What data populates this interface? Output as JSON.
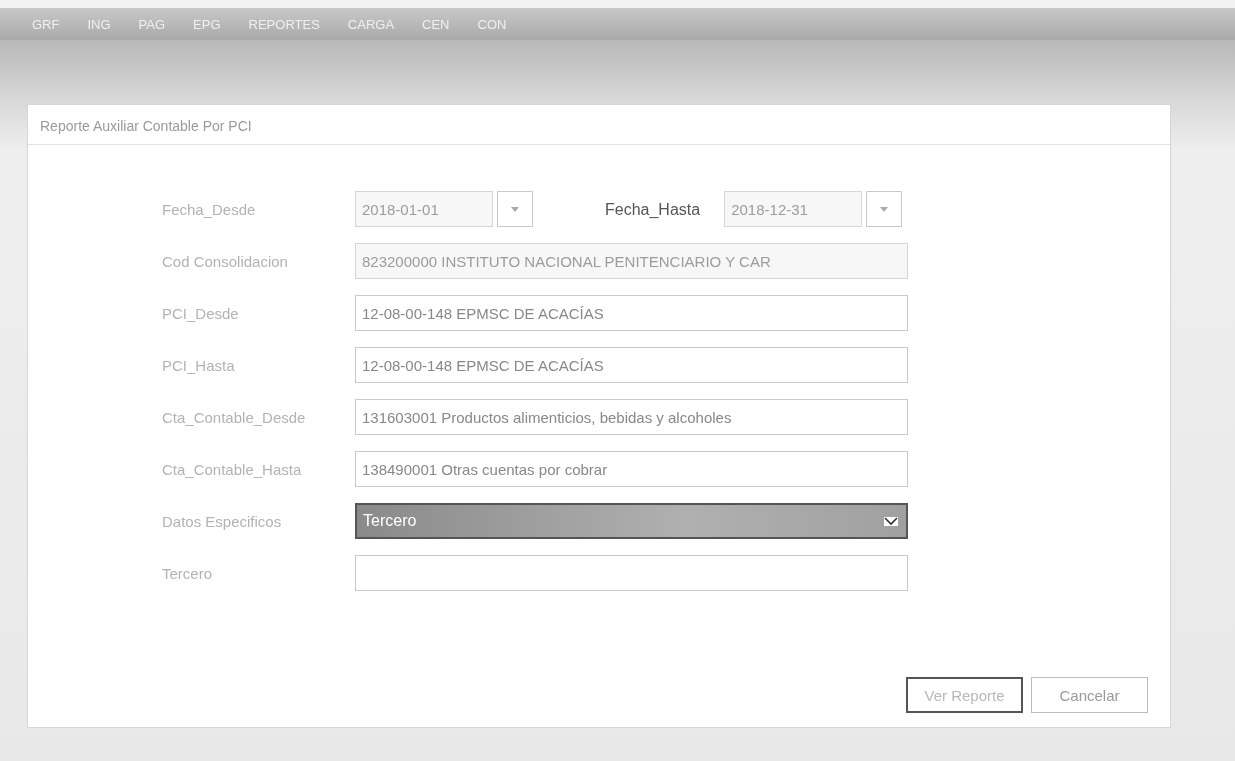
{
  "menu": [
    {
      "label": "GRF"
    },
    {
      "label": "ING"
    },
    {
      "label": "PAG"
    },
    {
      "label": "EPG"
    },
    {
      "label": "REPORTES"
    },
    {
      "label": "CARGA"
    },
    {
      "label": "CEN"
    },
    {
      "label": "CON"
    }
  ],
  "dialog": {
    "title": "Reporte Auxiliar Contable Por PCI",
    "rows": [
      {
        "fields": [
          {
            "kind": "date",
            "label": "Fecha_Desde",
            "value": "2018-01-01",
            "disabled": true
          },
          {
            "kind": "date",
            "label": "Fecha_Hasta",
            "value": "2018-12-31",
            "disabled": true
          }
        ]
      },
      {
        "fields": [
          {
            "kind": "text",
            "label": "Cod Consolidacion",
            "value": "823200000 INSTITUTO NACIONAL PENITENCIARIO Y CAR",
            "disabled": true
          }
        ]
      },
      {
        "fields": [
          {
            "kind": "text",
            "label": "PCI_Desde",
            "value": "12-08-00-148 EPMSC DE ACACÍAS",
            "disabled": false
          }
        ]
      },
      {
        "fields": [
          {
            "kind": "text",
            "label": "PCI_Hasta",
            "value": "12-08-00-148 EPMSC DE ACACÍAS",
            "disabled": false
          }
        ]
      },
      {
        "fields": [
          {
            "kind": "text",
            "label": "Cta_Contable_Desde",
            "value": "131603001 Productos alimenticios, bebidas y alcoholes",
            "disabled": false
          }
        ]
      },
      {
        "fields": [
          {
            "kind": "text",
            "label": "Cta_Contable_Hasta",
            "value": "138490001 Otras cuentas por cobrar",
            "disabled": false
          }
        ]
      },
      {
        "fields": [
          {
            "kind": "select",
            "label": "Datos Especificos",
            "value": "Tercero",
            "disabled": false
          }
        ]
      },
      {
        "fields": [
          {
            "kind": "text",
            "label": "Tercero",
            "disabled": false
          }
        ]
      }
    ],
    "buttons": [
      {
        "label": "Ver Reporte",
        "focused": true
      },
      {
        "label": "Cancelar",
        "focused": false
      }
    ]
  }
}
